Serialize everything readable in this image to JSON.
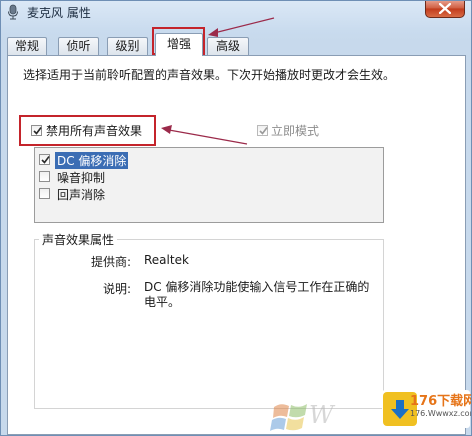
{
  "window": {
    "title": "麦克风 属性"
  },
  "tabs": [
    {
      "label": "常规"
    },
    {
      "label": "侦听"
    },
    {
      "label": "级别"
    },
    {
      "label": "增强"
    },
    {
      "label": "高级"
    }
  ],
  "active_tab": "增强",
  "description": "选择适用于当前聆听配置的声音效果。下次开始播放时更改才会生效。",
  "disable_all": {
    "label": "禁用所有声音效果",
    "checked": true
  },
  "immediate_mode": {
    "label": "立即模式",
    "checked": true,
    "disabled": true
  },
  "effects": [
    {
      "label": "DC 偏移消除",
      "checked": true,
      "selected": true
    },
    {
      "label": "噪音抑制",
      "checked": false,
      "selected": false
    },
    {
      "label": "回声消除",
      "checked": false,
      "selected": false
    }
  ],
  "properties": {
    "group_title": "声音效果属性",
    "provider_label": "提供商:",
    "provider_value": "Realtek",
    "description_label": "说明:",
    "description_line1": "DC 偏移消除功能使输入信号工作在正确的",
    "description_line2": "电平。"
  },
  "watermark": {
    "badge_text": "176下载网",
    "badge_sub": "176.Wwwxz.com",
    "logo_text": "W"
  },
  "colors": {
    "annotation_red": "#c4242b",
    "selection_blue": "#3b6db4"
  }
}
